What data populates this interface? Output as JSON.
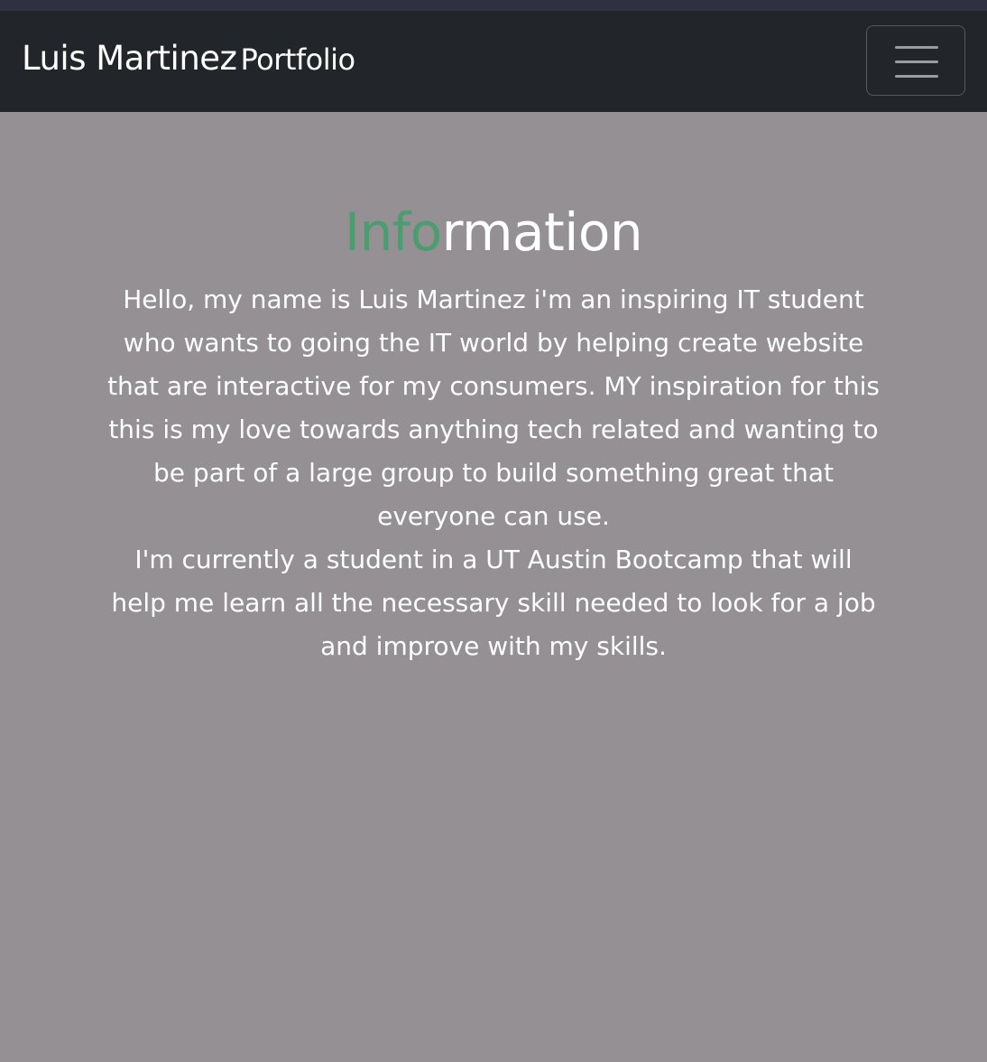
{
  "navbar": {
    "brand_name": "Luis Martinez",
    "brand_sub": "Portfolio",
    "toggler_icon": "hamburger-menu-icon"
  },
  "main": {
    "heading_accent": "Info",
    "heading_rest": "rmation",
    "paragraphs": [
      "Hello, my name is Luis Martinez i'm an inspiring IT student who wants to going the IT world by helping create website that are interactive for my consumers. MY inspiration for this this is my love towards anything tech related and wanting to be part of a large group to build something great that everyone can use.",
      "I'm currently a student in a UT Austin Bootcamp that will help me learn all the necessary skill needed to look for a job and improve with my skills."
    ]
  },
  "colors": {
    "page_background": "#949094",
    "navbar_background": "#22252a",
    "top_strip": "#2f3140",
    "accent_green": "#4a9d6f",
    "text": "#ffffff"
  }
}
